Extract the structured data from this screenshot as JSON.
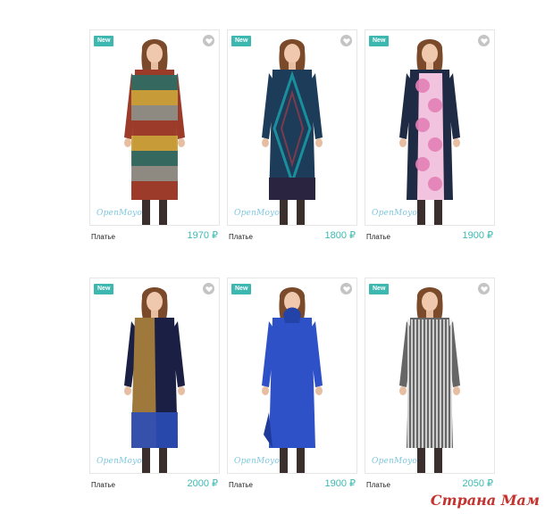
{
  "products": [
    {
      "badge": "New",
      "brand": "OpenMoyo",
      "name": "Платье",
      "price": "1970 ₽",
      "colors": {
        "main": "#9c3b2a",
        "accent": "#caa03a",
        "stripe2": "#2f6b63",
        "stripe3": "#8e8e86"
      }
    },
    {
      "badge": "New",
      "brand": "OpenMoyo",
      "name": "Платье",
      "price": "1800 ₽",
      "colors": {
        "main": "#1d3c5a",
        "accent": "#1a8f9c",
        "stripe2": "#2a2440",
        "stripe3": "#7a3b4b"
      }
    },
    {
      "badge": "New",
      "brand": "OpenMoyo",
      "name": "Платье",
      "price": "1900 ₽",
      "colors": {
        "main": "#1f2a44",
        "accent": "#e27fb5",
        "stripe2": "#f2c3df",
        "stripe3": "#9b4b8e"
      }
    },
    {
      "badge": "New",
      "brand": "OpenMoyo",
      "name": "Платье",
      "price": "2000 ₽",
      "colors": {
        "main": "#1b1f44",
        "accent": "#b58a3a",
        "stripe2": "#2a4db8",
        "stripe3": "#111111"
      }
    },
    {
      "badge": "New",
      "brand": "OpenMoyo",
      "name": "Платье",
      "price": "1900 ₽",
      "colors": {
        "main": "#2f51c8",
        "accent": "#2443a8",
        "stripe2": "#3a5fd6",
        "stripe3": "#203a9a"
      }
    },
    {
      "badge": "New",
      "brand": "OpenMoyo",
      "name": "Платье",
      "price": "2050 ₽",
      "colors": {
        "main": "#666666",
        "accent": "#e8e8e8",
        "stripe2": "#444444",
        "stripe3": "#bdbdbd"
      }
    }
  ],
  "watermark": "Страна Мам"
}
